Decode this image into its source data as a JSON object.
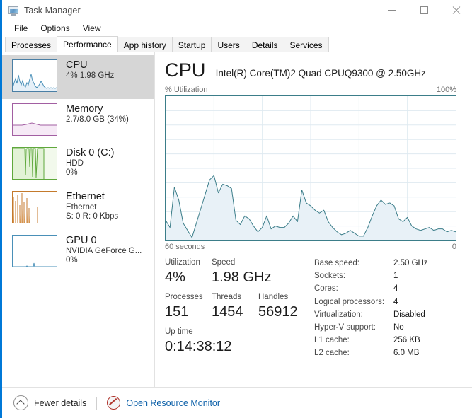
{
  "window": {
    "title": "Task Manager",
    "icon": "task-manager-icon",
    "controls": {
      "minimize": "minimize-icon",
      "maximize": "maximize-icon",
      "close": "close-icon"
    }
  },
  "menu": {
    "items": [
      "File",
      "Options",
      "View"
    ]
  },
  "tabs": {
    "active": "Performance",
    "items": [
      "Processes",
      "Performance",
      "App history",
      "Startup",
      "Users",
      "Details",
      "Services"
    ]
  },
  "sidebar": {
    "items": [
      {
        "name": "CPU",
        "title": "CPU",
        "sub1": "4%  1.98 GHz",
        "sub2": "",
        "selected": true,
        "color": "#4a90b8",
        "fill": "#eaf3f9"
      },
      {
        "name": "Memory",
        "title": "Memory",
        "sub1": "2.7/8.0 GB (34%)",
        "sub2": "",
        "selected": false,
        "color": "#a25fa2",
        "fill": "#f7eef7"
      },
      {
        "name": "Disk 0 (C:)",
        "title": "Disk 0 (C:)",
        "sub1": "HDD",
        "sub2": "0%",
        "selected": false,
        "color": "#5fa83c",
        "fill": "#f0f8ea"
      },
      {
        "name": "Ethernet",
        "title": "Ethernet",
        "sub1": "Ethernet",
        "sub2": "S: 0 R: 0 Kbps",
        "selected": false,
        "color": "#c47a2c",
        "fill": "#fdf5ec"
      },
      {
        "name": "GPU 0",
        "title": "GPU 0",
        "sub1": "NVIDIA GeForce G...",
        "sub2": "0%",
        "selected": false,
        "color": "#4a90b8",
        "fill": "#f4fafd"
      }
    ]
  },
  "main": {
    "heading": "CPU",
    "model": "Intel(R) Core(TM)2 Quad CPUQ9300 @ 2.50GHz",
    "graph_axis_title": "% Utilization",
    "graph_axis_max": "100%",
    "graph_time_left": "60 seconds",
    "graph_time_right": "0",
    "stats": {
      "utilization_label": "Utilization",
      "utilization_value": "4%",
      "speed_label": "Speed",
      "speed_value": "1.98 GHz",
      "processes_label": "Processes",
      "processes_value": "151",
      "threads_label": "Threads",
      "threads_value": "1454",
      "handles_label": "Handles",
      "handles_value": "56912",
      "uptime_label": "Up time",
      "uptime_value": "0:14:38:12"
    },
    "details": [
      {
        "key": "Base speed:",
        "value": "2.50 GHz"
      },
      {
        "key": "Sockets:",
        "value": "1"
      },
      {
        "key": "Cores:",
        "value": "4"
      },
      {
        "key": "Logical processors:",
        "value": "4"
      },
      {
        "key": "Virtualization:",
        "value": "Disabled"
      },
      {
        "key": "Hyper-V support:",
        "value": "No"
      },
      {
        "key": "L1 cache:",
        "value": "256 KB"
      },
      {
        "key": "L2 cache:",
        "value": "6.0 MB"
      }
    ]
  },
  "footer": {
    "fewer_details": "Fewer details",
    "open_resource_monitor": "Open Resource Monitor",
    "resource_monitor_icon": "resource-monitor-icon",
    "chevron_icon": "chevron-up-icon"
  },
  "colors": {
    "accent": "#0078d7",
    "graph_line": "#3b7d89",
    "graph_fill": "#e8f1f7",
    "graph_grid": "#dfeaf1",
    "link": "#0a5fa8"
  },
  "chart_data": {
    "type": "area",
    "title": "% Utilization",
    "xlabel": "60 seconds",
    "ylabel": "% Utilization",
    "ylim": [
      0,
      100
    ],
    "xlim": [
      60,
      0
    ],
    "grid": true,
    "grid_cols": 6,
    "grid_rows": 10,
    "series": [
      {
        "name": "CPU Utilization",
        "values": [
          14,
          9,
          37,
          28,
          12,
          7,
          2,
          12,
          22,
          32,
          42,
          45,
          33,
          39,
          38,
          36,
          14,
          11,
          17,
          15,
          10,
          6,
          9,
          17,
          8,
          10,
          9,
          9,
          12,
          17,
          13,
          35,
          26,
          24,
          21,
          19,
          21,
          13,
          9,
          6,
          4,
          5,
          7,
          5,
          3,
          3,
          9,
          17,
          24,
          28,
          25,
          26,
          24,
          15,
          13,
          16,
          10,
          8,
          7,
          8,
          9,
          7,
          8,
          8,
          6,
          7,
          6
        ]
      }
    ]
  }
}
